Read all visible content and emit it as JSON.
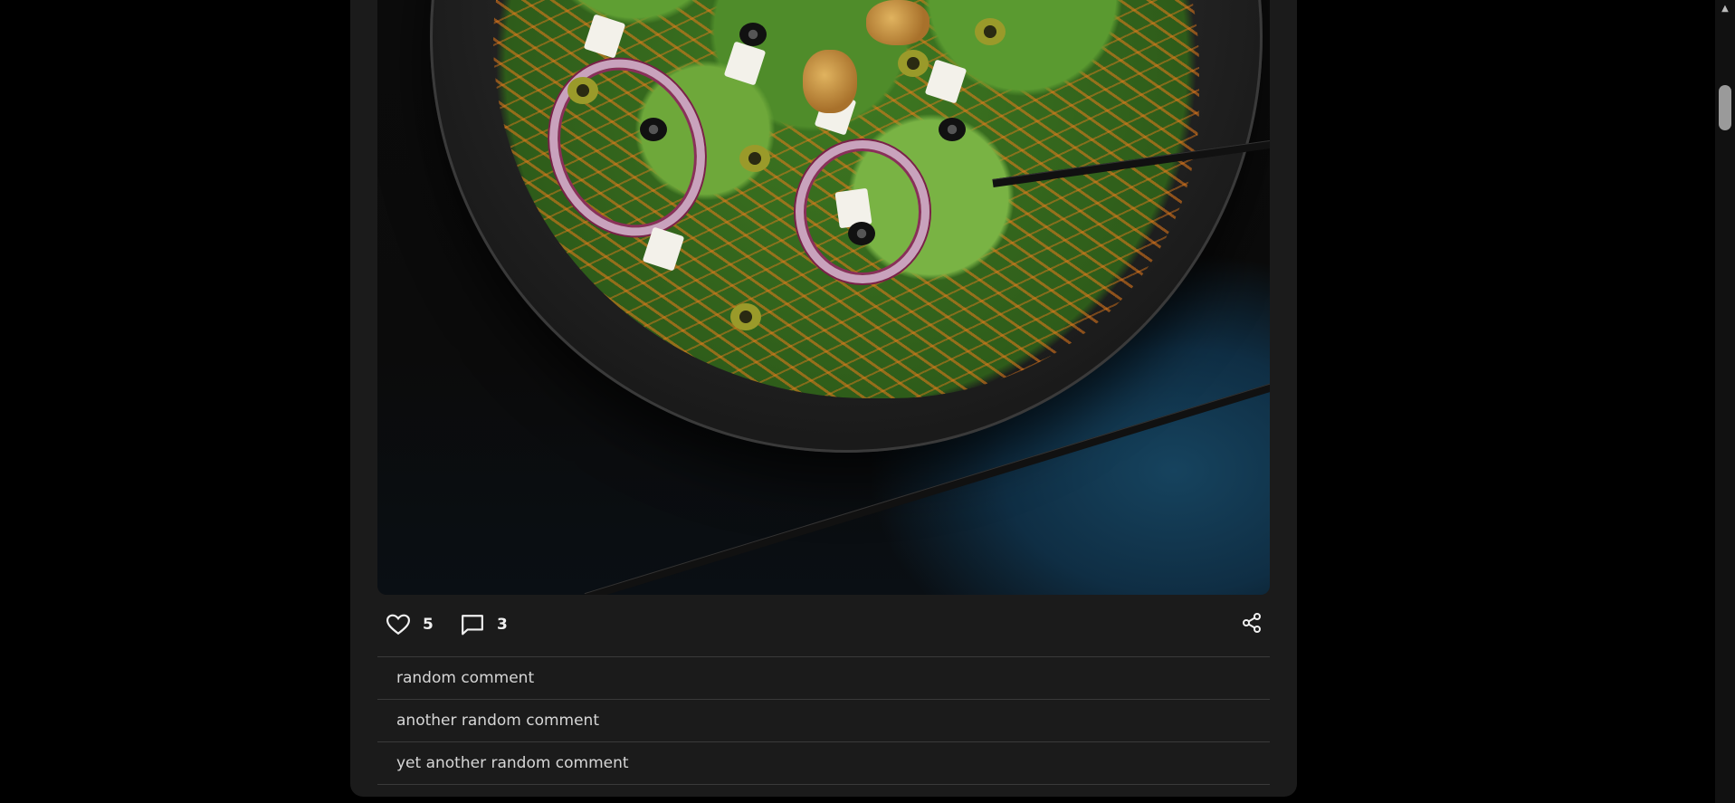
{
  "post": {
    "image_alt": "salad",
    "likes": "5",
    "comments_count": "3"
  },
  "comments": [
    "random comment",
    "another random comment",
    "yet another random comment"
  ],
  "icons": {
    "like": "heart-icon",
    "comment": "comment-icon",
    "share": "share-icon",
    "scroll_up": "arrow-up-icon"
  },
  "colors": {
    "page_background": "#000000",
    "card_background": "#1b1b1b",
    "divider": "#3a3a3a",
    "text": "#e6e6e6"
  }
}
